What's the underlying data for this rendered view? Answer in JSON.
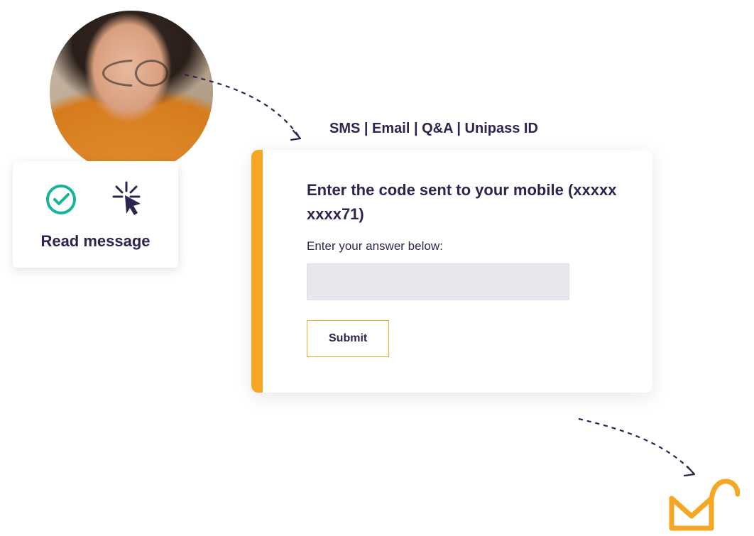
{
  "read_card": {
    "label": "Read message"
  },
  "tabs_text": "SMS | Email | Q&A | Unipass ID",
  "verify": {
    "heading": "Enter the code sent to your mobile (xxxxx xxxx71)",
    "sub": "Enter your answer below:",
    "submit_label": "Submit",
    "input_value": ""
  },
  "colors": {
    "accent": "#F5A623",
    "primary_text": "#2C2550",
    "check": "#18B39B"
  }
}
